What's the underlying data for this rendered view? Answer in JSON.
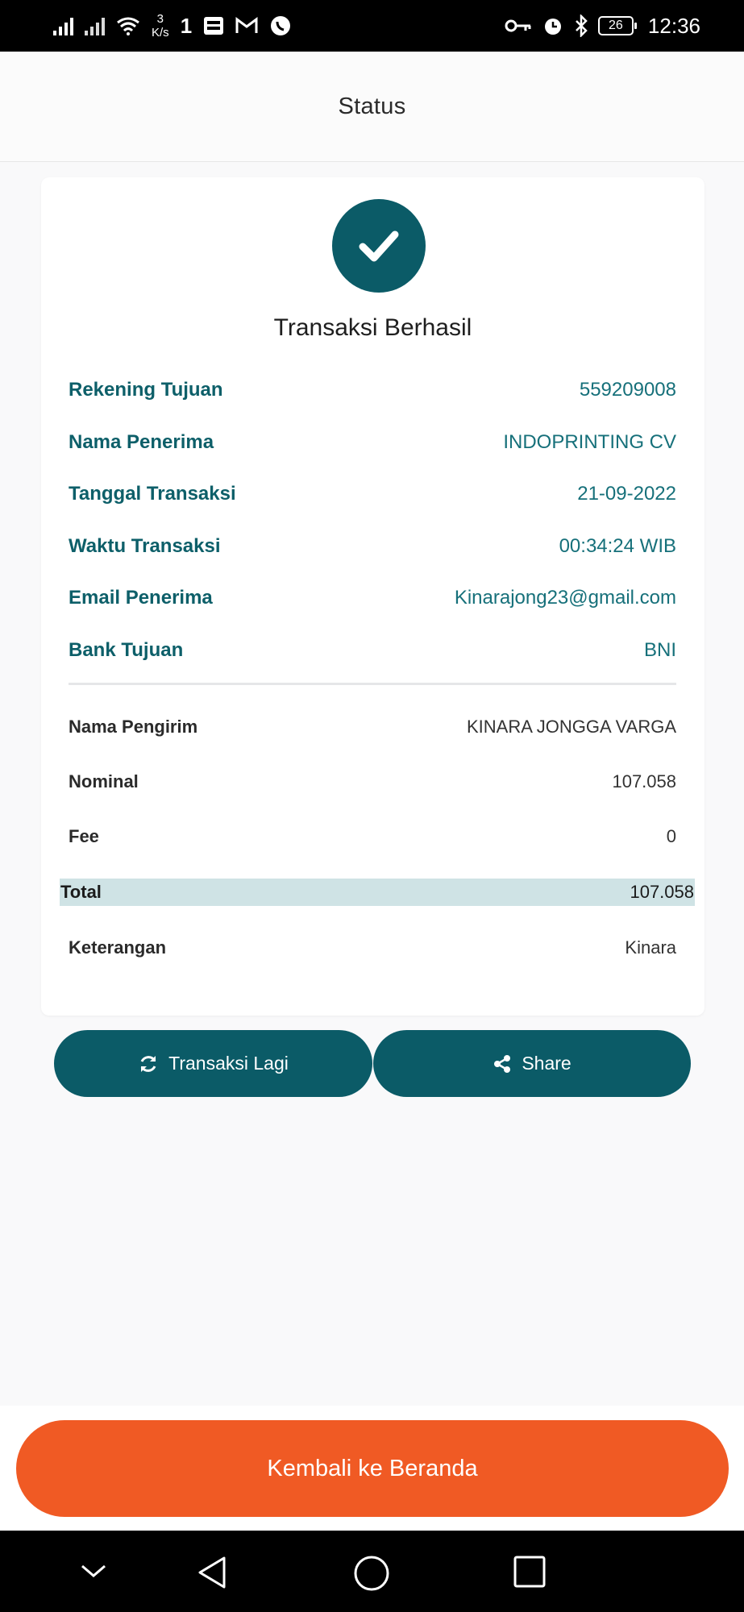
{
  "status_bar": {
    "speed_value": "3",
    "speed_unit": "K/s",
    "clock": "12:36",
    "battery": "26",
    "icons": [
      "signal-icon",
      "signal-icon",
      "wifi-icon",
      "notification-icon",
      "brimo-icon",
      "gmail-icon",
      "whatsapp-icon",
      "key-icon",
      "alarm-icon",
      "bluetooth-icon",
      "battery-icon"
    ]
  },
  "header": {
    "title": "Status"
  },
  "result": {
    "title": "Transaksi Berhasil",
    "icon": "check-icon",
    "icon_color": "#0b5b67"
  },
  "details_top": [
    {
      "label": "Rekening Tujuan",
      "value": "559209008"
    },
    {
      "label": "Nama Penerima",
      "value": "INDOPRINTING CV"
    },
    {
      "label": "Tanggal Transaksi",
      "value": "21-09-2022"
    },
    {
      "label": "Waktu Transaksi",
      "value": "00:34:24 WIB"
    },
    {
      "label": "Email Penerima",
      "value": "Kinarajong23@gmail.com"
    },
    {
      "label": "Bank Tujuan",
      "value": "BNI"
    }
  ],
  "details_bottom": {
    "sender": {
      "label": "Nama Pengirim",
      "value": "KINARA JONGGA VARGA"
    },
    "nominal": {
      "label": "Nominal",
      "value": "107.058"
    },
    "fee": {
      "label": "Fee",
      "value": "0"
    },
    "total": {
      "label": "Total",
      "value": "107.058"
    },
    "note": {
      "label": "Keterangan",
      "value": "Kinara"
    }
  },
  "actions": {
    "again_label": "Transaksi Lagi",
    "share_label": "Share"
  },
  "footer": {
    "home_label": "Kembali ke Beranda",
    "home_color": "#f05a24"
  },
  "nav": [
    "chevron-down-icon",
    "back-icon",
    "home-icon",
    "recents-icon"
  ]
}
